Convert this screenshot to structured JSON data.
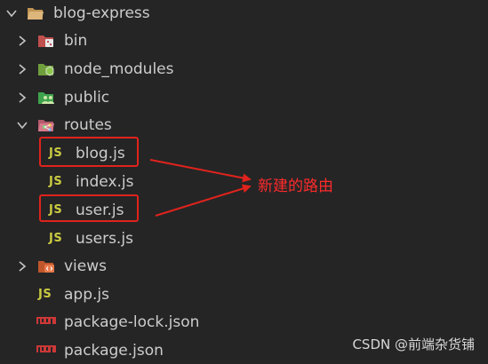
{
  "explorer": {
    "root": {
      "label": "blog-express",
      "icon": "folder-open-icon"
    },
    "items": [
      {
        "label": "bin",
        "icon": "bin-folder-icon"
      },
      {
        "label": "node_modules",
        "icon": "node-folder-icon"
      },
      {
        "label": "public",
        "icon": "public-folder-icon"
      },
      {
        "label": "routes",
        "icon": "routes-folder-icon"
      },
      {
        "label": "blog.js",
        "icon": "js-file-icon",
        "icon_text": "JS"
      },
      {
        "label": "index.js",
        "icon": "js-file-icon",
        "icon_text": "JS"
      },
      {
        "label": "user.js",
        "icon": "js-file-icon",
        "icon_text": "JS"
      },
      {
        "label": "users.js",
        "icon": "js-file-icon",
        "icon_text": "JS"
      },
      {
        "label": "views",
        "icon": "views-folder-icon"
      },
      {
        "label": "app.js",
        "icon": "js-file-icon",
        "icon_text": "JS"
      },
      {
        "label": "package-lock.json",
        "icon": "npm-icon"
      },
      {
        "label": "package.json",
        "icon": "npm-icon"
      }
    ]
  },
  "annotation": {
    "text": "新建的路由",
    "color": "#ff2a2a"
  },
  "watermark": "CSDN @前端杂货铺",
  "colors": {
    "background": "#252526",
    "text": "#cccccc",
    "js_icon": "#cbcb41",
    "highlight": "#e0231c"
  }
}
